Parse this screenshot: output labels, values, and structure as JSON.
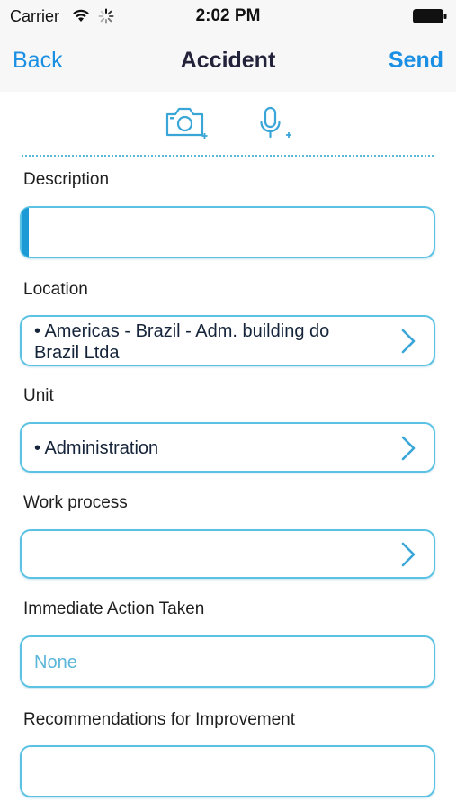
{
  "status": {
    "carrier": "Carrier",
    "time": "2:02 PM"
  },
  "nav": {
    "back_label": "Back",
    "title": "Accident",
    "send_label": "Send"
  },
  "toolbar": {
    "camera_icon": "camera-add-icon",
    "mic_icon": "microphone-add-icon"
  },
  "form": {
    "description": {
      "label": "Description",
      "value": ""
    },
    "location": {
      "label": "Location",
      "value_line1": "• Americas - Brazil - Adm. building do",
      "value_line2": "Brazil Ltda"
    },
    "unit": {
      "label": "Unit",
      "value": "• Administration"
    },
    "work_process": {
      "label": "Work process",
      "value": ""
    },
    "immediate_action": {
      "label": "Immediate Action Taken",
      "placeholder": "None"
    },
    "recommendations": {
      "label": "Recommendations for Improvement",
      "value": ""
    }
  },
  "colors": {
    "accent": "#1a8fe3",
    "field_border": "#5bc2e3",
    "placeholder": "#5cb6d9"
  }
}
